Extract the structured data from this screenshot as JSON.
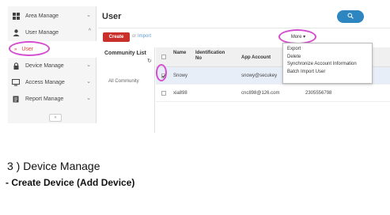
{
  "sidebar": {
    "items": [
      {
        "label": "Area Manage",
        "icon": "grid-icon",
        "chevron": "⌄"
      },
      {
        "label": "User Manage",
        "icon": "user-icon",
        "chevron": "^"
      },
      {
        "label": "User",
        "icon": "bullet-icon",
        "chevron": ""
      },
      {
        "label": "Device Manage",
        "icon": "lock-icon",
        "chevron": "⌄"
      },
      {
        "label": "Access Manage",
        "icon": "monitor-icon",
        "chevron": "⌄"
      },
      {
        "label": "Report Manage",
        "icon": "document-icon",
        "chevron": "⌄"
      }
    ],
    "collapse": "«"
  },
  "main": {
    "title": "User",
    "create_label": "Create",
    "import_prefix": "or ",
    "import_label": "Import",
    "more_label": "More ▾",
    "more_menu": [
      "Export",
      "Delete",
      "Synchronize Account Information",
      "Batch Import User"
    ]
  },
  "community": {
    "title": "Community List",
    "refresh": "↻",
    "items": [
      "All Community"
    ]
  },
  "table": {
    "columns": [
      "Name",
      "Identification No",
      "App Account"
    ],
    "rows": [
      {
        "name": "Snowy",
        "id": "",
        "account": "snowy@secukey",
        "phone": "",
        "checked": true
      },
      {
        "name": "xia898",
        "id": "",
        "account": "cnc898@126.com",
        "phone": "2305556798",
        "checked": false
      }
    ]
  },
  "doc": {
    "heading": "3 ) Device Manage",
    "subheading": "- Create Device (Add Device)"
  },
  "colors": {
    "accent_red": "#c9302c",
    "search_blue": "#2e86c1",
    "highlight_magenta": "#d44fd0"
  }
}
